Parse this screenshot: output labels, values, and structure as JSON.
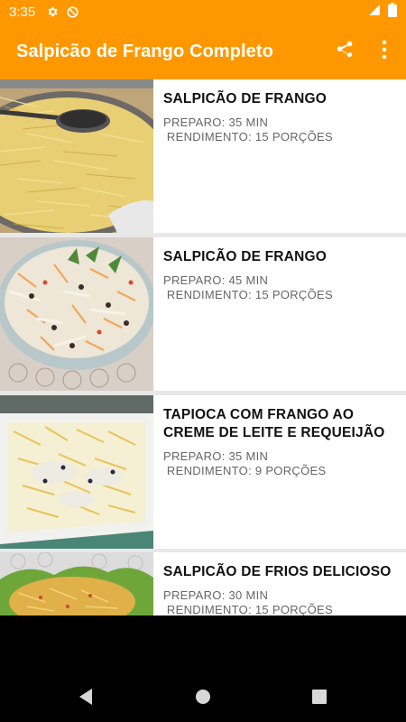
{
  "status_bar": {
    "time": "3:35",
    "icons": [
      "gear-icon",
      "data-saver-icon",
      "signal-icon",
      "battery-icon"
    ]
  },
  "app_bar": {
    "title": "Salpicão de Frango Completo",
    "actions": [
      "share-icon",
      "more-vert-icon"
    ]
  },
  "colors": {
    "primary": "#ff9800",
    "list_background": "#e8e8e8",
    "card": "#ffffff",
    "title_text": "#111111",
    "meta_text": "#666666"
  },
  "recipes": [
    {
      "title": "SALPICÃO DE FRANGO",
      "preparo": "PREPARO: 35 MIN",
      "rendimento": " RENDIMENTO: 15 PORÇÕES"
    },
    {
      "title": "SALPICÃO DE FRANGO",
      "preparo": "PREPARO: 45 MIN",
      "rendimento": " RENDIMENTO: 15 PORÇÕES"
    },
    {
      "title": "TAPIOCA COM FRANGO AO CREME DE LEITE E REQUEIJÃO",
      "preparo": "PREPARO: 35 MIN",
      "rendimento": " RENDIMENTO: 9 PORÇÕES"
    },
    {
      "title": "SALPICÃO DE FRIOS DELICIOSO",
      "preparo": "PREPARO: 30 MIN",
      "rendimento": " RENDIMENTO: 15 PORÇÕES"
    }
  ],
  "nav_bar": {
    "buttons": [
      "back-icon",
      "home-icon",
      "recents-icon"
    ]
  }
}
